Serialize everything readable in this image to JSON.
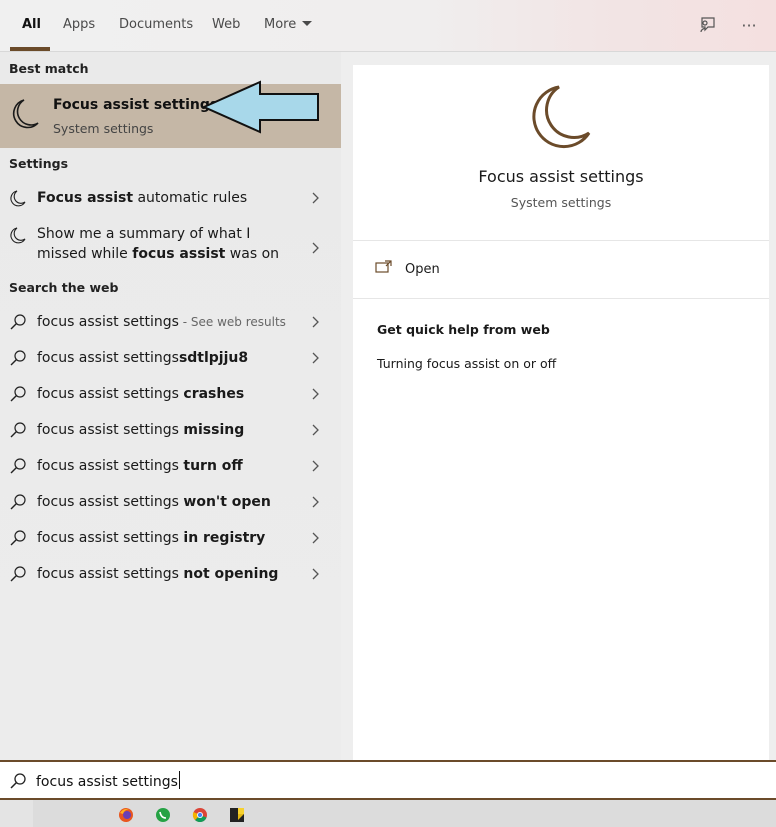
{
  "tabs": [
    {
      "label": "All",
      "active": true
    },
    {
      "label": "Apps"
    },
    {
      "label": "Documents"
    },
    {
      "label": "Web"
    },
    {
      "label": "More"
    }
  ],
  "top_icons": [
    "feedback-icon",
    "more-options-icon"
  ],
  "more_glyph": "···",
  "sections": {
    "best_match": "Best match",
    "settings": "Settings",
    "search_web": "Search the web"
  },
  "best_match": {
    "title": "Focus assist settings",
    "subtitle": "System settings",
    "icon": "moon-icon"
  },
  "settings_items": [
    {
      "pre": "",
      "bold": "Focus assist",
      "post": " automatic rules"
    },
    {
      "pre": "Show me a summary of what I missed while ",
      "bold": "focus assist",
      "post": " was on"
    }
  ],
  "web_items": [
    {
      "pre": "focus assist settings",
      "bold": "",
      "muted": " - See web results"
    },
    {
      "pre": "focus assist settings",
      "bold": "sdtlpjju8",
      "muted": ""
    },
    {
      "pre": "focus assist settings ",
      "bold": "crashes",
      "muted": ""
    },
    {
      "pre": "focus assist settings ",
      "bold": "missing",
      "muted": ""
    },
    {
      "pre": "focus assist settings ",
      "bold": "turn off",
      "muted": ""
    },
    {
      "pre": "focus assist settings ",
      "bold": "won't open",
      "muted": ""
    },
    {
      "pre": "focus assist settings ",
      "bold": "in registry",
      "muted": ""
    },
    {
      "pre": "focus assist settings ",
      "bold": "not opening",
      "muted": ""
    }
  ],
  "preview": {
    "title": "Focus assist settings",
    "subtitle": "System settings",
    "open_label": "Open",
    "help_title": "Get quick help from web",
    "help_link": "Turning focus assist on or off"
  },
  "search": {
    "value": "focus assist settings"
  },
  "taskbar": [
    "firefox-icon",
    "whatsapp-icon",
    "chrome-icon",
    "sticky-notes-icon"
  ],
  "colors": {
    "accent": "#6b4b2a",
    "highlight": "#c5b7a6",
    "arrow_fill": "#a8d8ea"
  }
}
